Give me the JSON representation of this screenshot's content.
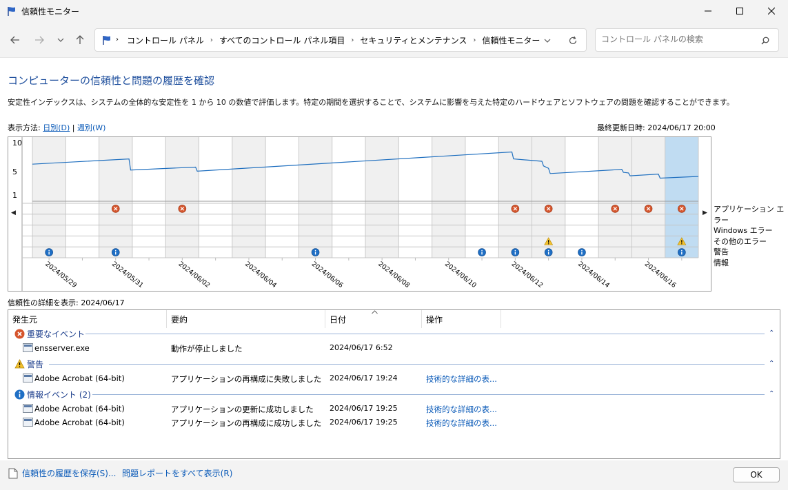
{
  "window": {
    "title": "信頼性モニター"
  },
  "address": {
    "crumbs": [
      "コントロール パネル",
      "すべてのコントロール パネル項目",
      "セキュリティとメンテナンス",
      "信頼性モニター"
    ],
    "search_placeholder": "コントロール パネルの検索"
  },
  "main": {
    "heading": "コンピューターの信頼性と問題の履歴を確認",
    "description": "安定性インデックスは、システムの全体的な安定性を 1 から 10 の数値で評価します。特定の期間を選択することで、システムに影響を与えた特定のハードウェアとソフトウェアの問題を確認することができます。",
    "view_by_label": "表示方法:",
    "view_days": "日別(D)",
    "view_sep": "|",
    "view_weeks": "週別(W)",
    "last_updated": "最終更新日時: 2024/06/17 20:00"
  },
  "chart": {
    "y_ticks": [
      "10",
      "5",
      "1"
    ],
    "date_labels": [
      "2024/05/29",
      "2024/05/31",
      "2024/06/02",
      "2024/06/04",
      "2024/06/06",
      "2024/06/08",
      "2024/06/10",
      "2024/06/12",
      "2024/06/14",
      "2024/06/16"
    ],
    "row_labels": [
      "アプリケーション エラー",
      "Windows エラー",
      "その他のエラー",
      "警告",
      "情報"
    ],
    "line_color": "#1f6fbf",
    "selected_color": "#c0dcf2",
    "shaded_color": "#f0f0f0"
  },
  "chart_data": {
    "type": "line",
    "days": 20,
    "selected_day": 19,
    "shaded_days": [
      0,
      2,
      4,
      6,
      8,
      10,
      12,
      14,
      15,
      17,
      18
    ],
    "stability_index": [
      [
        0,
        6.3
      ],
      [
        2.9,
        7.2
      ],
      [
        2.95,
        5.3
      ],
      [
        4.9,
        5.8
      ],
      [
        4.95,
        5.1
      ],
      [
        14.4,
        8.4
      ],
      [
        14.45,
        7.2
      ],
      [
        15.3,
        6.8
      ],
      [
        15.35,
        6.0
      ],
      [
        15.5,
        5.6
      ],
      [
        15.55,
        4.7
      ],
      [
        17.7,
        5.4
      ],
      [
        17.75,
        4.9
      ],
      [
        17.9,
        4.8
      ],
      [
        17.95,
        4.3
      ],
      [
        18.8,
        4.6
      ],
      [
        18.85,
        3.9
      ],
      [
        20,
        4.2
      ]
    ],
    "application_errors": [
      2,
      4,
      14,
      15,
      17,
      18,
      19
    ],
    "warnings": [
      15,
      19
    ],
    "information": [
      0,
      2,
      8,
      13,
      14,
      15,
      16,
      19
    ],
    "ylim": [
      1,
      10
    ]
  },
  "details": {
    "label": "信頼性の詳細を表示: 2024/06/17",
    "columns": [
      "発生元",
      "要約",
      "日付",
      "操作"
    ],
    "groups": [
      {
        "title": "重要なイベント",
        "icon": "error",
        "rows": [
          {
            "source": "ensserver.exe",
            "summary": "動作が停止しました",
            "date": "2024/06/17 6:52",
            "action": ""
          }
        ]
      },
      {
        "title": "警告",
        "icon": "warning",
        "rows": [
          {
            "source": "Adobe Acrobat (64-bit)",
            "summary": "アプリケーションの再構成に失敗しました",
            "date": "2024/06/17 19:24",
            "action": "技術的な詳細の表..."
          }
        ]
      },
      {
        "title": "情報イベント (2)",
        "icon": "info",
        "rows": [
          {
            "source": "Adobe Acrobat (64-bit)",
            "summary": "アプリケーションの更新に成功しました",
            "date": "2024/06/17 19:25",
            "action": "技術的な詳細の表..."
          },
          {
            "source": "Adobe Acrobat (64-bit)",
            "summary": "アプリケーションの再構成に成功しました",
            "date": "2024/06/17 19:25",
            "action": "技術的な詳細の表..."
          }
        ]
      }
    ]
  },
  "footer": {
    "save_link": "信頼性の履歴を保存(S)...",
    "reports_link": "問題レポートをすべて表示(R)",
    "ok_label": "OK"
  }
}
